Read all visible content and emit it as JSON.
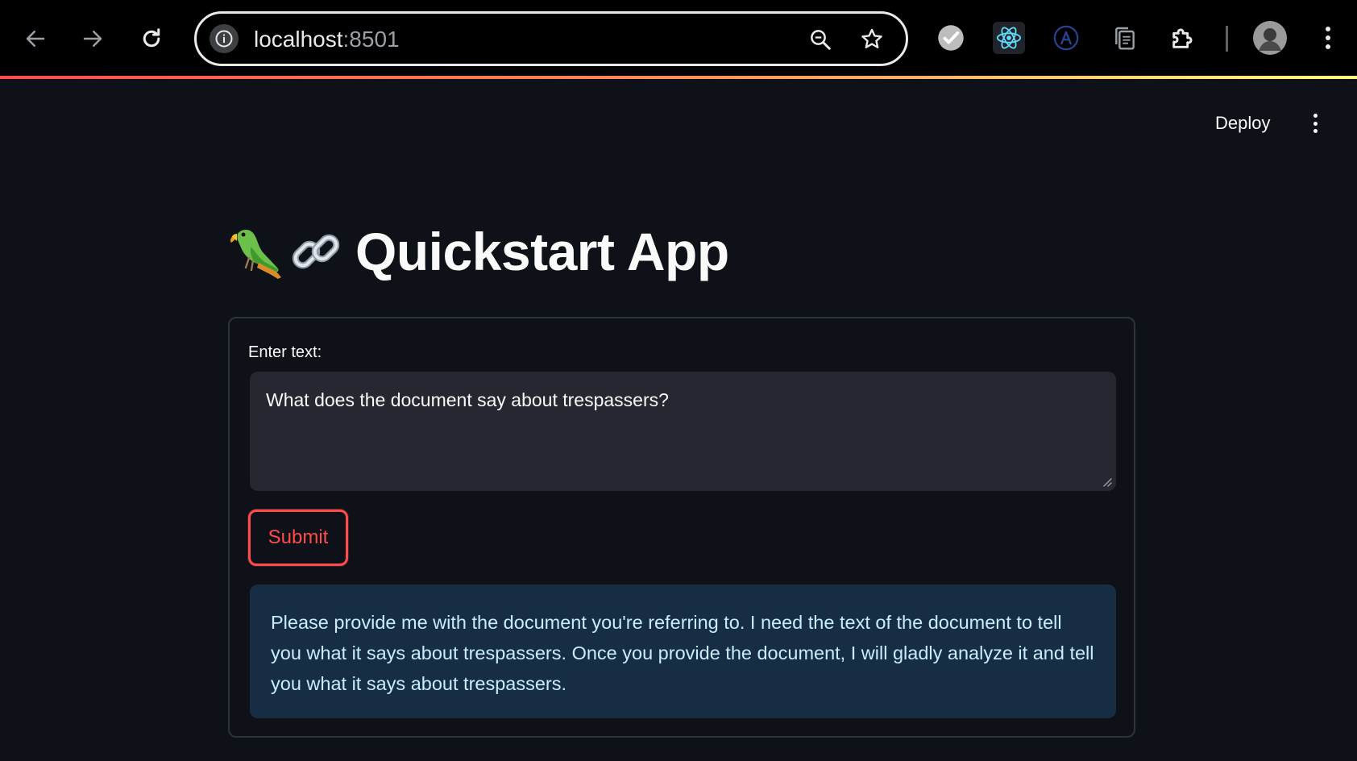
{
  "browser": {
    "url_host": "localhost",
    "url_port": ":8501",
    "icons": {
      "back": "arrow-left-icon",
      "forward": "arrow-right-icon",
      "reload": "reload-icon",
      "info": "info-icon",
      "zoom": "zoom-icon",
      "bookmark": "star-icon",
      "extensions": [
        "check-circle-icon",
        "react-icon",
        "a-circle-icon",
        "copy-icon",
        "puzzle-icon"
      ],
      "profile": "avatar",
      "menu": "kebab-menu-icon"
    }
  },
  "app": {
    "deploy_label": "Deploy",
    "title": "Quickstart App",
    "title_emoji": [
      "parrot",
      "link"
    ],
    "form": {
      "label": "Enter text:",
      "input_value": "What does the document say about trespassers?",
      "submit_label": "Submit"
    },
    "response": "Please provide me with the document you're referring to. I need the text of the document to tell you what it says about trespassers. Once you provide the document, I will gladly analyze it and tell you what it says about trespassers."
  },
  "colors": {
    "background": "#0e1117",
    "textarea_bg": "#262730",
    "accent": "#ff4b4b",
    "info_bg": "#172d43",
    "info_text": "#c7ebff"
  }
}
